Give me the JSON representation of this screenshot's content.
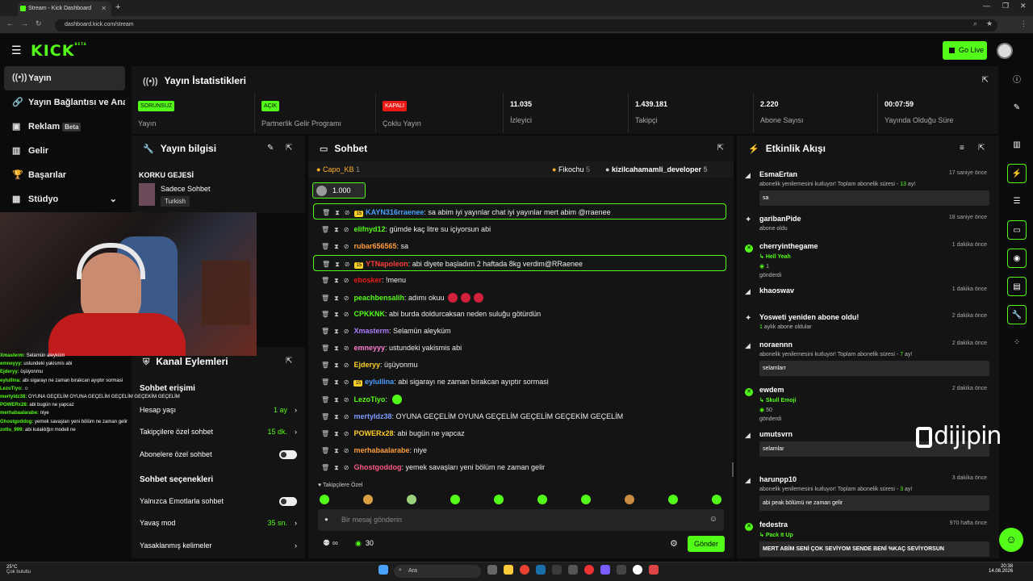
{
  "browser": {
    "tab_title": "Stream - Kick Dashboard",
    "url": "dashboard.kick.com/stream"
  },
  "header": {
    "logo": "KICK",
    "logo_sup": "BETA",
    "go_live": "Go Live"
  },
  "sidebar": {
    "items": [
      {
        "label": "Yayın",
        "icon": "broadcast-icon"
      },
      {
        "label": "Yayın Bağlantısı ve Anahtarı",
        "icon": "link-icon"
      },
      {
        "label": "Reklam",
        "icon": "ad-icon",
        "badge": "Beta"
      },
      {
        "label": "Gelir",
        "icon": "chart-icon"
      },
      {
        "label": "Başarılar",
        "icon": "trophy-icon"
      },
      {
        "label": "Stüdyo",
        "icon": "studio-icon"
      }
    ]
  },
  "stats": {
    "title": "Yayın İstatistikleri",
    "items": [
      {
        "tag": "SORUNSUZ",
        "label": "Yayın"
      },
      {
        "tag": "AÇIK",
        "label": "Partnerlik Gelir Programı"
      },
      {
        "tag": "KAPALI",
        "label": "Çoklu Yayın"
      },
      {
        "value": "11.035",
        "label": "İzleyici"
      },
      {
        "value": "1.439.181",
        "label": "Takipçi"
      },
      {
        "value": "2.220",
        "label": "Abone Sayısı"
      },
      {
        "value": "00:07:59",
        "label": "Yayında Olduğu Süre"
      }
    ]
  },
  "info": {
    "title": "Yayın bilgisi",
    "stream_title": "KORKU GEJESİ",
    "category": "Sadece Sohbet",
    "language": "Turkish"
  },
  "kanal": {
    "title": "Kanal Eylemleri",
    "chat_access": "Sohbet erişimi",
    "account_age_label": "Hesap yaşı",
    "account_age_value": "1 ay",
    "followers_label": "Takipçilere özel sohbet",
    "followers_value": "15 dk.",
    "subs_label": "Abonelere özel sohbet",
    "chat_options": "Sohbet seçenekleri",
    "emotes_label": "Yalnızca Emotlarla sohbet",
    "slow_label": "Yavaş mod",
    "slow_value": "35 sn.",
    "banned_label": "Yasaklanmış kelimeler"
  },
  "overlay_chat": [
    {
      "n": "Xmasterm:",
      "t": "Selamün aleyküm"
    },
    {
      "n": "emneyyy:",
      "t": "ustundeki yakismis abi"
    },
    {
      "n": "Ejderyy:",
      "t": "üşüyonmu"
    },
    {
      "n": "eylullina:",
      "t": "abi sigarayı ne zaman bırakcan ayıptır sormasi"
    },
    {
      "n": "LezoTiyo:",
      "t": "☺"
    },
    {
      "n": "mertyldz38:",
      "t": "OYUNA GEÇELİM OYUNA GEÇELİM GEÇELİM GEÇEKİM GEÇELİM"
    },
    {
      "n": "POWERx28:",
      "t": "abi bugün ne yapcaz"
    },
    {
      "n": "merhabaalarabe:",
      "t": "niye"
    },
    {
      "n": "Ghostgoddog:",
      "t": "yemek savaşları yeni bölüm ne zaman gelir"
    },
    {
      "n": "zotlu_999:",
      "t": "abi kulaklığın modeli ne"
    }
  ],
  "chat": {
    "title": "Sohbet",
    "top_gifters": [
      {
        "name": "Capo_KB",
        "count": "1"
      },
      {
        "name": "Fikochu",
        "count": "5"
      },
      {
        "name": "kizilcahamamli_developer",
        "count": "5"
      }
    ],
    "pinned_amount": "1.000",
    "messages": [
      {
        "user": "KAYN316rraenee",
        "color": "#4a9eff",
        "badge": "15",
        "text": "sa abim iyi yayınlar chat iyi yayınlar mert abim @rraenee",
        "hl": true
      },
      {
        "user": "elifnyd12",
        "color": "#53fc18",
        "text": "gümde kaç litre su içiyorsun abi"
      },
      {
        "user": "rubar656565",
        "color": "#ff9d3b",
        "text": "sa"
      },
      {
        "user": "YTNapoleon",
        "color": "#ff3b3b",
        "badge": "15",
        "text": "abi diyete başladım 2 haftada 8kg verdim@RRaenee",
        "hl": true
      },
      {
        "user": "ebosker",
        "color": "#e91916",
        "text": "!menu"
      },
      {
        "user": "peachbensalih",
        "color": "#53fc18",
        "text": "adımı okuu",
        "emotes": 3,
        "emote_color": "#d0203a"
      },
      {
        "user": "CPKKNK",
        "color": "#53fc18",
        "text": "abi burda doldurcaksan neden suluğu götürdün"
      },
      {
        "user": "Xmasterm",
        "color": "#b07cff",
        "text": "Selamün aleyküm"
      },
      {
        "user": "emneyyy",
        "color": "#ff7cd0",
        "text": "ustundeki yakismis abi"
      },
      {
        "user": "Ejderyy",
        "color": "#ffd028",
        "text": "üşüyonmu"
      },
      {
        "user": "eylullina",
        "color": "#4a9eff",
        "badge": "15",
        "text": "abi sigarayı ne zaman bırakcan ayıptır sormasi"
      },
      {
        "user": "LezoTiyo",
        "color": "#53fc18",
        "text": "",
        "emotes": 1,
        "emote_color": "#53fc18"
      },
      {
        "user": "mertyldz38",
        "color": "#7c9cff",
        "text": "OYUNA GEÇELİM OYUNA GEÇELİM GEÇELİM GEÇEKİM GEÇELİM"
      },
      {
        "user": "POWERx28",
        "color": "#ffd028",
        "text": "abi bugün ne yapcaz"
      },
      {
        "user": "merhabaalarabe",
        "color": "#ff9d3b",
        "text": "niye"
      },
      {
        "user": "Ghostgoddog",
        "color": "#ff5a8a",
        "text": "yemek savaşları yeni bölüm ne zaman gelir"
      }
    ],
    "followers_only": "Takipçilere Özel",
    "input_placeholder": "Bir mesaj gönderin",
    "points": "30",
    "send": "Gönder"
  },
  "activity": {
    "title": "Etkinlik Akışı",
    "items": [
      {
        "name": "EsmaErtan",
        "time": "17 saniye önce",
        "desc": "abonelik yenilemesini kutluyor! Toplam abonelik süresi - ",
        "months": "13",
        "unit": " ay!",
        "box": "sa",
        "icon": "resub"
      },
      {
        "name": "garibanPide",
        "time": "18 saniye önce",
        "desc": "abone oldu",
        "icon": "sub"
      },
      {
        "name": "cherryinthegame",
        "time": "1 dakika önce",
        "gift": "Hell Yeah",
        "amount": "1",
        "sent": "gönderdi",
        "icon": "gift"
      },
      {
        "name": "khaoswav",
        "time": "1 dakika önce",
        "icon": "resub"
      },
      {
        "name": "Yosweti yeniden abone oldu!",
        "time": "2 dakika önce",
        "desc2_n": "1",
        "desc2": " aylık abone oldular",
        "icon": "sub"
      },
      {
        "name": "noraennn",
        "time": "2 dakika önce",
        "desc": "abonelik yenilemesini kutluyor! Toplam abonelik süresi - ",
        "months": "7",
        "unit": " ay!",
        "box": "selamlarr",
        "icon": "resub"
      },
      {
        "name": "ewdem",
        "time": "2 dakika önce",
        "gift": "Skull Emoji",
        "amount": "50",
        "sent": "gönderdi",
        "icon": "gift"
      },
      {
        "name": "umutsvrn",
        "time": "",
        "box": "selamlar",
        "icon": "resub"
      },
      {
        "name": "harunpp10",
        "time": "3 dakika önce",
        "desc": "abonelik yenilemesini kutluyor! Toplam abonelik süresi - ",
        "months": "3",
        "unit": " ay!",
        "box": "abi peak bölümü ne zaman gelir",
        "icon": "resub"
      },
      {
        "name": "fedestra",
        "time": "970 hafta önce",
        "gift": "Pack It Up",
        "box": "MERT ABİM SENİ ÇOK SEVİYOM SENDE BENİ %KAÇ SEVİYORSUN",
        "icon": "gift"
      }
    ]
  },
  "watermark": "dijipin",
  "taskbar": {
    "weather_temp": "25°C",
    "weather_desc": "Çok bulutlu",
    "search": "Ara",
    "time": "20:38",
    "date": "14.08.2026"
  },
  "colors": {
    "accent": "#53fc18",
    "bg": "#0b0b0b",
    "panel": "#141414",
    "danger": "#e91916"
  }
}
